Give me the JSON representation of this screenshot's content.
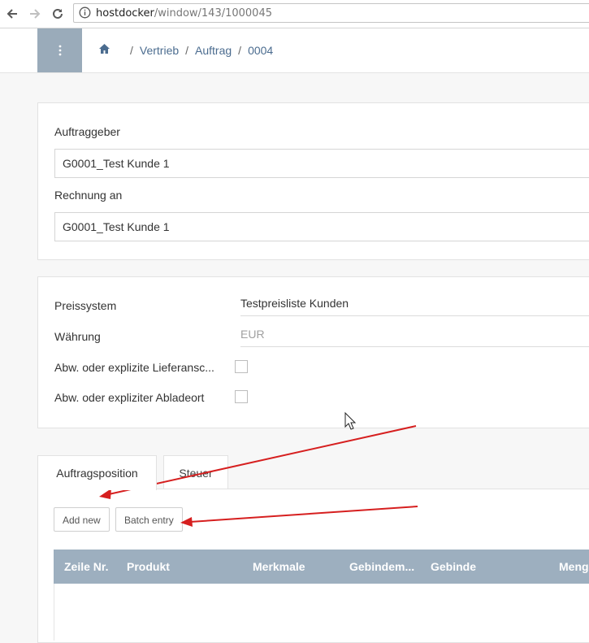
{
  "browser": {
    "url_host": "hostdocker",
    "url_path": "/window/143/1000045"
  },
  "topbar": {
    "menu_icon": "kebab-icon",
    "breadcrumb": [
      "Vertrieb",
      "Auftrag",
      "0004"
    ]
  },
  "header_panel": {
    "auftraggeber_label": "Auftraggeber",
    "auftraggeber_value": "G0001_Test Kunde 1",
    "rechnung_label": "Rechnung an",
    "rechnung_value": "G0001_Test Kunde 1"
  },
  "pricing_panel": {
    "preissystem_label": "Preissystem",
    "preissystem_value": "Testpreisliste Kunden",
    "waehrung_label": "Währung",
    "waehrung_value": "EUR",
    "liefer_label": "Abw. oder explizite Lieferansc...",
    "ablade_label": "Abw. oder expliziter Abladeort"
  },
  "tabs": [
    "Auftragsposition",
    "Steuer"
  ],
  "buttons": {
    "add_new": "Add new",
    "batch_entry": "Batch entry"
  },
  "table": {
    "columns": [
      "Zeile Nr.",
      "Produkt",
      "Merkmale",
      "Gebindem...",
      "Gebinde",
      "Meng"
    ]
  },
  "colors": {
    "accent": "#9aabba",
    "table_header": "#9dafbf",
    "link": "#4b6c8f",
    "annotation_arrow": "#d61f1f"
  }
}
